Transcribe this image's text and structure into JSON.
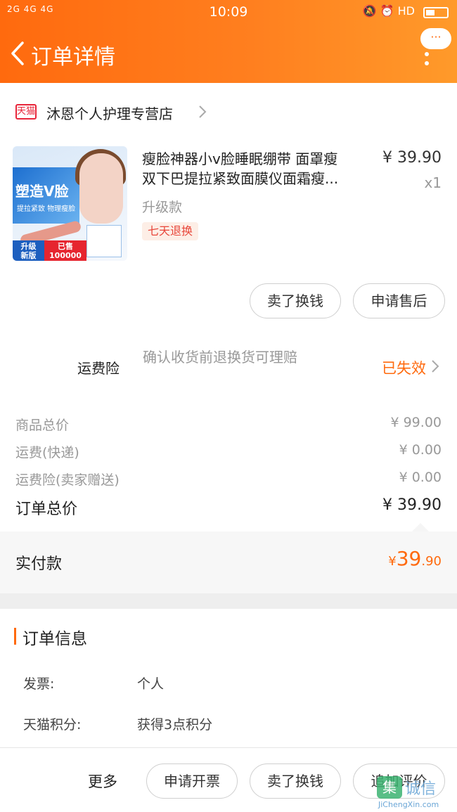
{
  "status_bar": {
    "network": "2G 4G 4G",
    "time": "10:09",
    "indicators": "HD"
  },
  "header": {
    "title": "订单详情",
    "menu_dots": "···"
  },
  "store": {
    "badge": "天猫",
    "name": "沐恩个人护理专营店"
  },
  "product": {
    "image_texts": {
      "headline": "塑造V脸",
      "subline": "提拉紧致 物理瘦脸",
      "upgrade": "升级\n新版",
      "sold": "已售\n100000"
    },
    "title_line1": "瘦脸神器小v脸睡眠绷带 面罩瘦",
    "title_line2": "双下巴提拉紧致面膜仪面霜瘦...",
    "price": "¥ 39.90",
    "quantity": "x1",
    "variant": "升级款",
    "return_tag": "七天退换",
    "actions": [
      "卖了换钱",
      "申请售后"
    ]
  },
  "shipping_insurance": {
    "label": "运费险",
    "description": "确认收货前退换货可理赔",
    "status": "已失效"
  },
  "prices": [
    {
      "label": "商品总价",
      "value": "¥ 99.00"
    },
    {
      "label": "运费(快递)",
      "value": "¥ 0.00"
    },
    {
      "label": "运费险(卖家赠送)",
      "value": "¥ 0.00"
    }
  ],
  "order_total": {
    "label": "订单总价",
    "value": "¥ 39.90"
  },
  "paid": {
    "label": "实付款",
    "currency": "¥",
    "integer": "39",
    "decimal": ".90"
  },
  "order_info": {
    "title": "订单信息",
    "rows": [
      {
        "key": "发票:",
        "value": "个人"
      },
      {
        "key": "天猫积分:",
        "value": "获得3点积分"
      }
    ]
  },
  "bottom_bar": {
    "more": "更多",
    "buttons": [
      "申请开票",
      "卖了换钱",
      "追加评价"
    ]
  },
  "watermark": {
    "logo": "集",
    "cn": "诚信",
    "en": "JiChengXin.com"
  },
  "colors": {
    "brand_orange": "#ff6a0e",
    "tmall_red": "#e8253a"
  }
}
